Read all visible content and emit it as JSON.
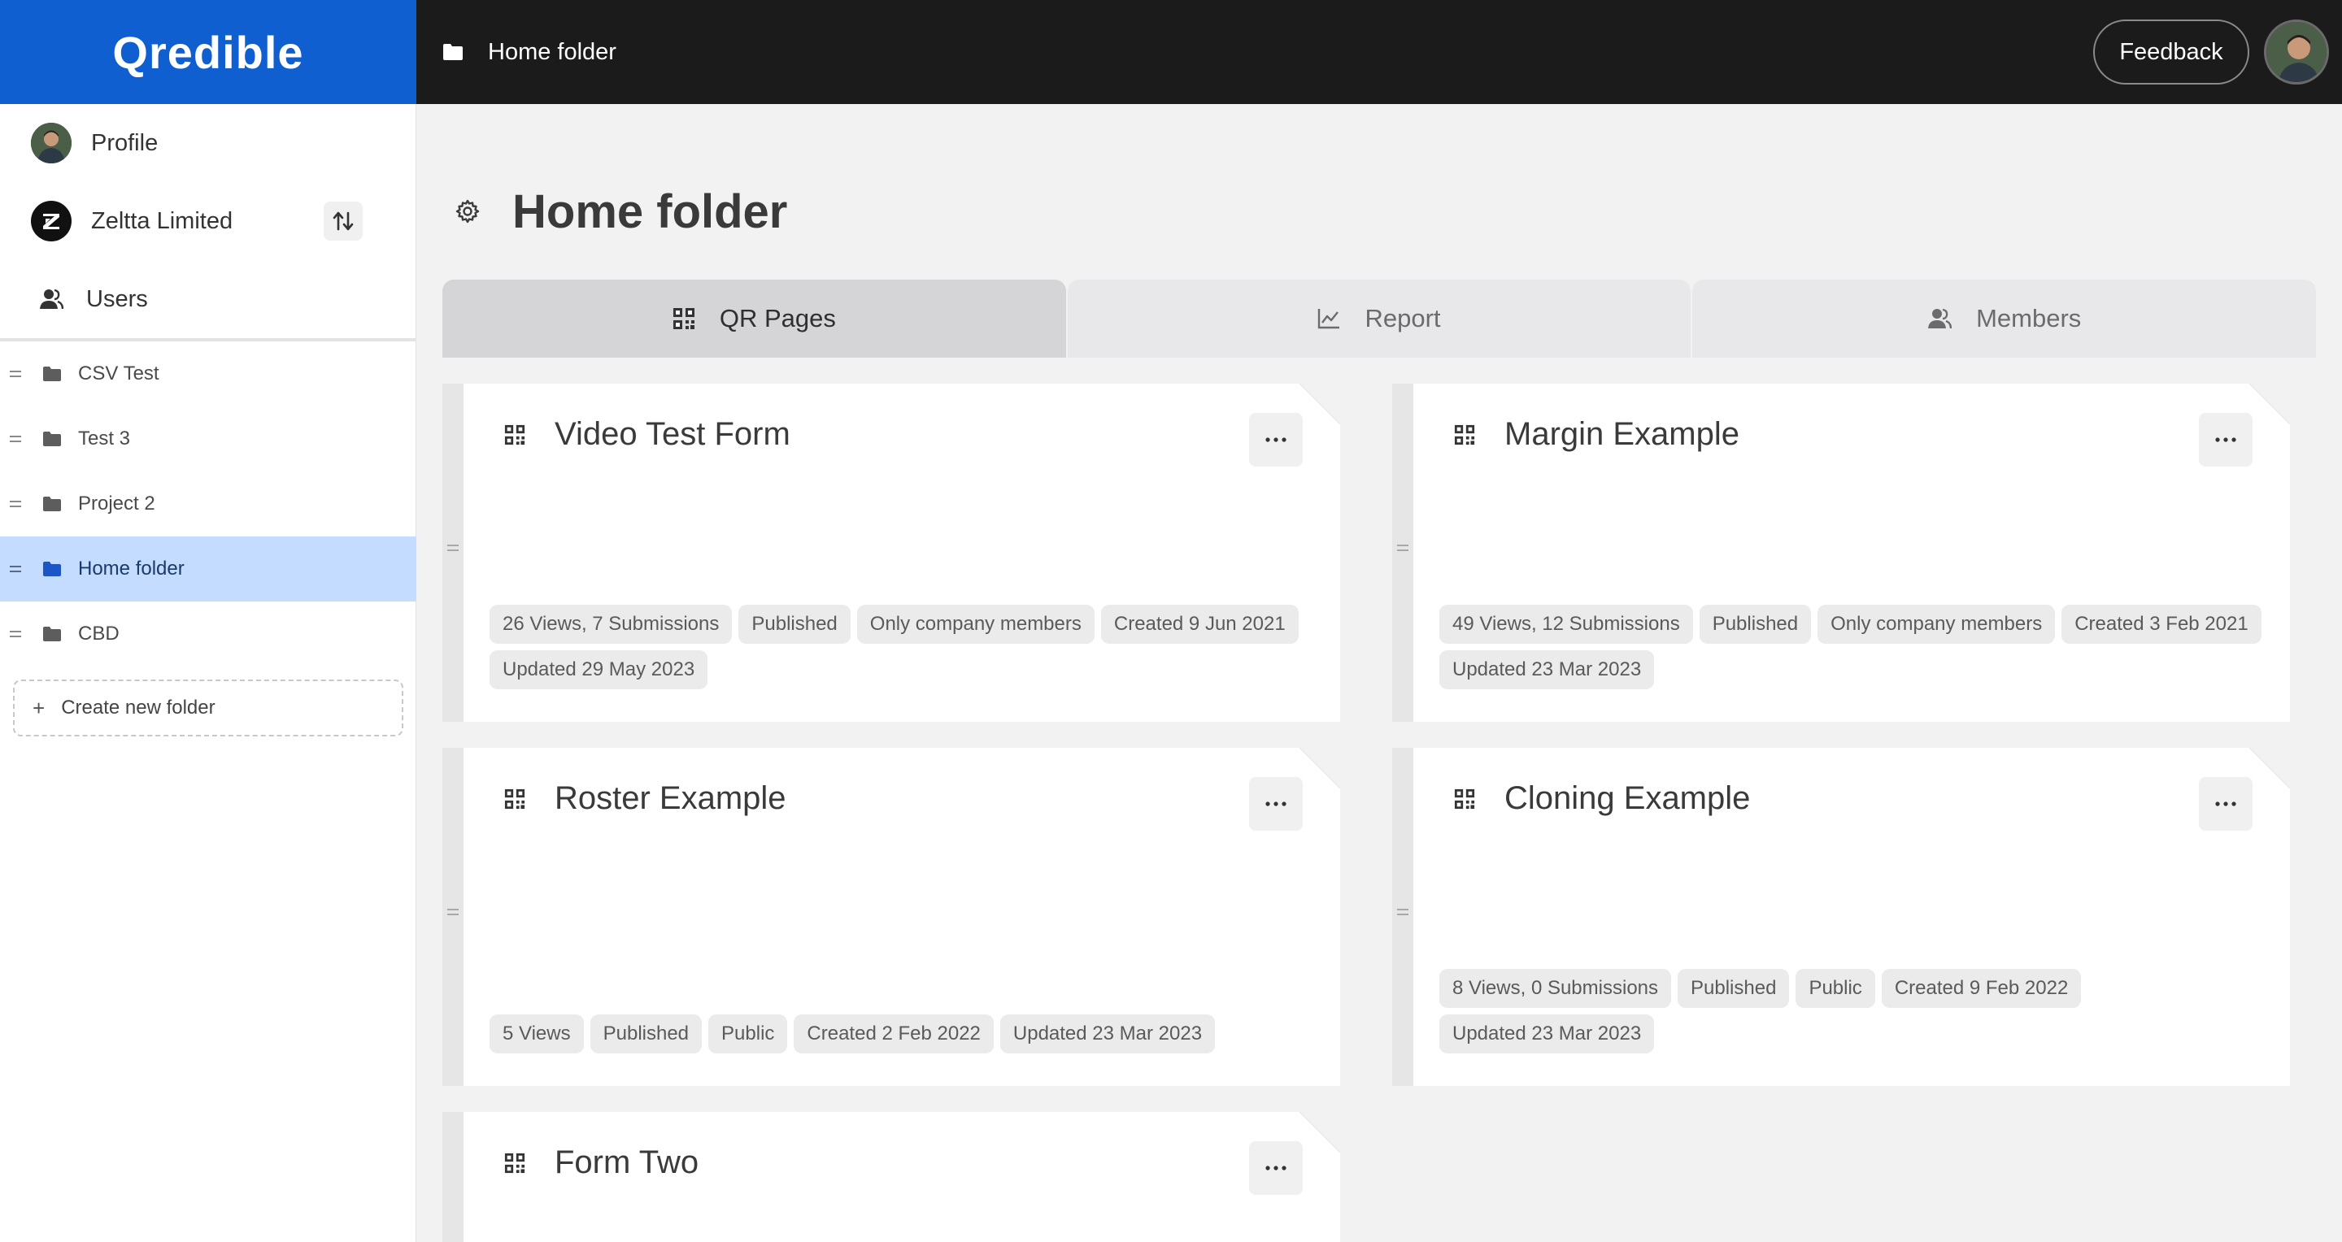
{
  "app": {
    "brand": "Qredible",
    "brand_color": "#0f5fd0"
  },
  "topbar": {
    "breadcrumb": "Home folder",
    "feedback_label": "Feedback"
  },
  "sidebar": {
    "profile_label": "Profile",
    "org_label": "Zeltta Limited",
    "users_label": "Users",
    "folders": [
      {
        "label": "CSV Test",
        "active": false
      },
      {
        "label": "Test 3",
        "active": false
      },
      {
        "label": "Project 2",
        "active": false
      },
      {
        "label": "Home folder",
        "active": true
      },
      {
        "label": "CBD",
        "active": false
      }
    ],
    "new_folder_label": "Create new folder"
  },
  "main": {
    "title": "Home folder",
    "tabs": [
      {
        "label": "QR Pages",
        "icon": "qr-icon",
        "active": true
      },
      {
        "label": "Report",
        "icon": "chart-icon",
        "active": false
      },
      {
        "label": "Members",
        "icon": "members-icon",
        "active": false
      }
    ],
    "cards": [
      {
        "title": "Video Test Form",
        "tags": [
          "26 Views, 7 Submissions",
          "Published",
          "Only company members",
          "Created 9 Jun 2021",
          "Updated 29 May 2023"
        ]
      },
      {
        "title": "Margin Example",
        "tags": [
          "49 Views, 12 Submissions",
          "Published",
          "Only company members",
          "Created 3 Feb 2021",
          "Updated 23 Mar 2023"
        ]
      },
      {
        "title": "Roster Example",
        "tags": [
          "5 Views",
          "Published",
          "Public",
          "Created 2 Feb 2022",
          "Updated 23 Mar 2023"
        ]
      },
      {
        "title": "Cloning Example",
        "tags": [
          "8 Views, 0 Submissions",
          "Published",
          "Public",
          "Created 9 Feb 2022",
          "Updated 23 Mar 2023"
        ]
      },
      {
        "title": "Form Two",
        "tags": []
      }
    ]
  }
}
